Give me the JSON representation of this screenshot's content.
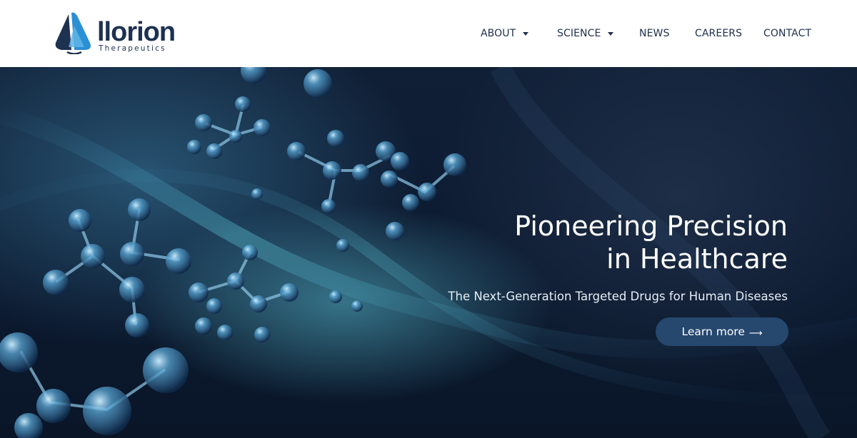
{
  "brand": {
    "name": "llorion",
    "tagline": "Therapeutics",
    "colors": {
      "dark": "#1d3151",
      "accent": "#2a8fd3",
      "light_accent": "#5fb6e8"
    }
  },
  "nav": {
    "items": [
      {
        "label": "ABOUT",
        "has_dropdown": true
      },
      {
        "label": "SCIENCE",
        "has_dropdown": true
      },
      {
        "label": "NEWS",
        "has_dropdown": false
      },
      {
        "label": "CAREERS",
        "has_dropdown": false
      },
      {
        "label": "CONTACT",
        "has_dropdown": false
      }
    ],
    "dropdown_icon": "caret-down-icon"
  },
  "hero": {
    "title_line1": "Pioneering Precision",
    "title_line2": "in Healthcare",
    "subtitle": "The Next-Generation Targeted Drugs for Human Diseases",
    "cta_label": "Learn more",
    "cta_icon": "arrow-right-icon",
    "cta_arrow": "⟶",
    "cta_color": "#26486f",
    "background_image": "molecules-and-dna-helix"
  }
}
